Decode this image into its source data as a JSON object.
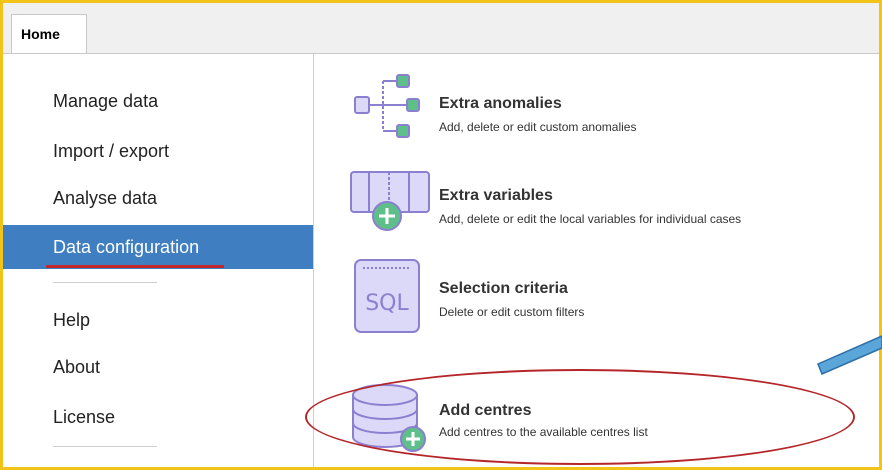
{
  "tabs": [
    {
      "label": "Home",
      "active": true
    }
  ],
  "sidebar": {
    "items": [
      {
        "label": "Manage data",
        "selected": false
      },
      {
        "label": "Import / export",
        "selected": false
      },
      {
        "label": "Analyse data",
        "selected": false
      },
      {
        "label": "Data configuration",
        "selected": true
      },
      {
        "label": "Help",
        "selected": false
      },
      {
        "label": "About",
        "selected": false
      },
      {
        "label": "License",
        "selected": false
      }
    ]
  },
  "main": {
    "items": [
      {
        "icon": "tree-structure-icon",
        "title": "Extra anomalies",
        "desc": "Add, delete or edit custom anomalies"
      },
      {
        "icon": "table-columns-add-icon",
        "title": "Extra variables",
        "desc": "Add, delete or edit the local variables for individual cases"
      },
      {
        "icon": "sql-icon",
        "icon_text": "SQL",
        "title": "Selection criteria",
        "desc": "Delete or edit custom filters"
      },
      {
        "icon": "database-add-icon",
        "title": "Add centres",
        "desc": "Add centres to the available centres list"
      }
    ]
  },
  "colors": {
    "highlight_border": "#f2c41a",
    "selected_bg": "#3f7ec0",
    "annotation_red": "#b5262a",
    "annotation_arrow": "#5aa6d8",
    "icon_purple": "#8b7fd0",
    "icon_fill": "#dcd8f8",
    "icon_green": "#5fbf8a"
  }
}
